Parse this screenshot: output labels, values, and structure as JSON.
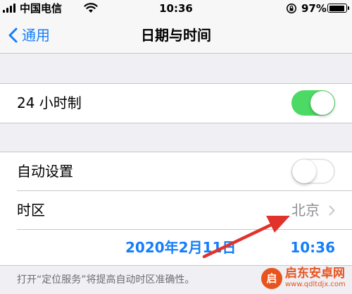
{
  "status_bar": {
    "carrier": "中国电信",
    "time": "10:36",
    "battery_percent": "97%",
    "battery_level": 0.97,
    "icons": [
      "signal-icon",
      "wifi-icon",
      "orientation-lock-icon",
      "battery-icon"
    ]
  },
  "nav": {
    "back_label": "通用",
    "title": "日期与时间"
  },
  "settings": {
    "hour24": {
      "label": "24 小时制",
      "on": true
    },
    "auto_set": {
      "label": "自动设置",
      "on": false
    },
    "timezone": {
      "label": "时区",
      "value": "北京"
    },
    "date": "2020年2月11日",
    "time": "10:36"
  },
  "footnote": "打开“定位服务”将提高自动时区准确性。",
  "watermark": {
    "name": "启东安卓网",
    "url": "www.qdltdjx.com",
    "icon_char": "启"
  },
  "colors": {
    "accent": "#147efb",
    "toggle_on": "#4cd964",
    "annotation_arrow": "#e2322c",
    "watermark": "#e8541e"
  }
}
